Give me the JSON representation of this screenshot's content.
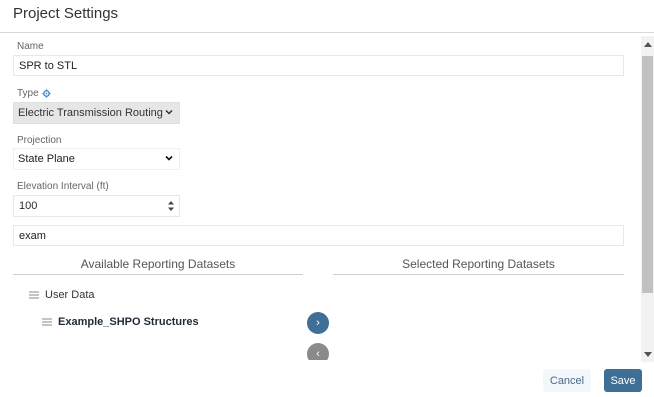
{
  "header": {
    "title": "Project Settings"
  },
  "form": {
    "name_label": "Name",
    "name_value": "SPR to STL",
    "type_label": "Type",
    "type_value": "Electric Transmission Routing",
    "projection_label": "Projection",
    "projection_value": "State Plane",
    "elevation_label": "Elevation Interval (ft)",
    "elevation_value": "100",
    "filter_value": "exam"
  },
  "datasets": {
    "available_title": "Available Reporting Datasets",
    "selected_title": "Selected Reporting Datasets",
    "available_items": [
      {
        "label": "User Data"
      },
      {
        "label": "Example_SHPO Structures"
      }
    ],
    "move_right_glyph": "›",
    "move_left_glyph": "‹"
  },
  "footer": {
    "cancel_label": "Cancel",
    "save_label": "Save"
  },
  "colors": {
    "accent": "#3f6f96",
    "disabled": "#8a8a8a",
    "type_info_icon": "#3b7fc4"
  },
  "icons": {
    "type_info": "gear-icon",
    "drag": "drag-handle-icon",
    "dropdown": "chevron-down-icon"
  }
}
